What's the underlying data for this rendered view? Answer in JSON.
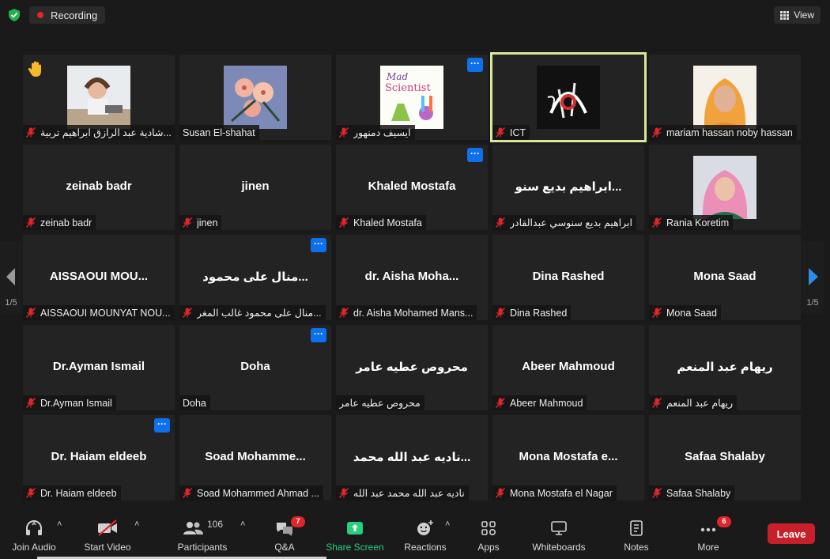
{
  "topbar": {
    "recording_label": "Recording",
    "view_label": "View"
  },
  "pagination": {
    "left": "1/5",
    "right": "1/5"
  },
  "tiles": [
    {
      "label": "شادية عبد الرازق ابراهيم تربية...",
      "center": "",
      "photo": "girl",
      "hand": true,
      "more": false,
      "muted": true,
      "active": false
    },
    {
      "label": "Susan El-shahat",
      "center": "",
      "photo": "flower",
      "hand": false,
      "more": false,
      "muted": false,
      "active": false
    },
    {
      "label": "ايسيف دمنهور",
      "center": "",
      "photo": "scientist",
      "hand": false,
      "more": true,
      "muted": true,
      "active": false
    },
    {
      "label": "ICT",
      "center": "",
      "photo": "calligraphy",
      "hand": false,
      "more": false,
      "muted": true,
      "active": true
    },
    {
      "label": "mariam hassan noby hassan",
      "center": "",
      "photo": "woman",
      "hand": false,
      "more": false,
      "muted": true,
      "active": false
    },
    {
      "label": "zeinab badr",
      "center": "zeinab badr",
      "photo": "",
      "hand": false,
      "more": false,
      "muted": true,
      "active": false
    },
    {
      "label": "jinen",
      "center": "jinen",
      "photo": "",
      "hand": false,
      "more": false,
      "muted": true,
      "active": false
    },
    {
      "label": "Khaled Mostafa",
      "center": "Khaled Mostafa",
      "photo": "",
      "hand": false,
      "more": true,
      "muted": true,
      "active": false
    },
    {
      "label": "ابراهيم بديع سنوسي عبدالقادر",
      "center": "ابراهيم بديع سنو...",
      "photo": "",
      "hand": false,
      "more": false,
      "muted": true,
      "active": false
    },
    {
      "label": "Rania Koretim",
      "center": "",
      "photo": "hijab",
      "hand": false,
      "more": false,
      "muted": true,
      "active": false
    },
    {
      "label": "AISSAOUI MOUNYAT NOU...",
      "center": "AISSAOUI  MOU...",
      "photo": "",
      "hand": false,
      "more": false,
      "muted": true,
      "active": false
    },
    {
      "label": "منال على محمود غالب المغر...",
      "center": "منال على محمود...",
      "photo": "",
      "hand": false,
      "more": true,
      "muted": true,
      "active": false
    },
    {
      "label": "dr. Aisha Mohamed Mans...",
      "center": "dr. Aisha Moha...",
      "photo": "",
      "hand": false,
      "more": false,
      "muted": true,
      "active": false
    },
    {
      "label": "Dina Rashed",
      "center": "Dina Rashed",
      "photo": "",
      "hand": false,
      "more": false,
      "muted": true,
      "active": false
    },
    {
      "label": "Mona Saad",
      "center": "Mona Saad",
      "photo": "",
      "hand": false,
      "more": false,
      "muted": true,
      "active": false
    },
    {
      "label": "Dr.Ayman Ismail",
      "center": "Dr.Ayman Ismail",
      "photo": "",
      "hand": false,
      "more": false,
      "muted": true,
      "active": false
    },
    {
      "label": "Doha",
      "center": "Doha",
      "photo": "",
      "hand": false,
      "more": true,
      "muted": false,
      "active": false
    },
    {
      "label": "محروص عطيه عامر",
      "center": "محروص عطيه عامر",
      "photo": "",
      "hand": false,
      "more": false,
      "muted": false,
      "active": false
    },
    {
      "label": "Abeer Mahmoud",
      "center": "Abeer Mahmoud",
      "photo": "",
      "hand": false,
      "more": false,
      "muted": true,
      "active": false
    },
    {
      "label": "ريهام عبد المنعم",
      "center": "ريهام عبد المنعم",
      "photo": "",
      "hand": false,
      "more": false,
      "muted": true,
      "active": false
    },
    {
      "label": "Dr. Haiam eldeeb",
      "center": "Dr. Haiam eldeeb",
      "photo": "",
      "hand": false,
      "more": true,
      "muted": true,
      "active": false
    },
    {
      "label": "Soad Mohammed Ahmad ...",
      "center": "Soad  Mohamme...",
      "photo": "",
      "hand": false,
      "more": false,
      "muted": true,
      "active": false
    },
    {
      "label": "ناديه عبد الله محمد عبد الله",
      "center": "ناديه عبد الله محمد...",
      "photo": "",
      "hand": false,
      "more": false,
      "muted": true,
      "active": false
    },
    {
      "label": "Mona Mostafa el Nagar",
      "center": "Mona  Mostafa  e...",
      "photo": "",
      "hand": false,
      "more": false,
      "muted": true,
      "active": false
    },
    {
      "label": "Safaa Shalaby",
      "center": "Safaa Shalaby",
      "photo": "",
      "hand": false,
      "more": false,
      "muted": true,
      "active": false
    }
  ],
  "toolbar": {
    "join_audio": "Join Audio",
    "start_video": "Start Video",
    "participants": "Participants",
    "participants_count": "106",
    "qa": "Q&A",
    "qa_badge": "7",
    "share_screen": "Share Screen",
    "reactions": "Reactions",
    "apps": "Apps",
    "whiteboards": "Whiteboards",
    "notes": "Notes",
    "more": "More",
    "more_badge": "6",
    "leave": "Leave"
  },
  "colors": {
    "accent_blue": "#0e71eb",
    "recording_red": "#e0262a",
    "share_green": "#26d07c",
    "active_outline": "#d8e89a",
    "leave_red": "#c7202a"
  }
}
